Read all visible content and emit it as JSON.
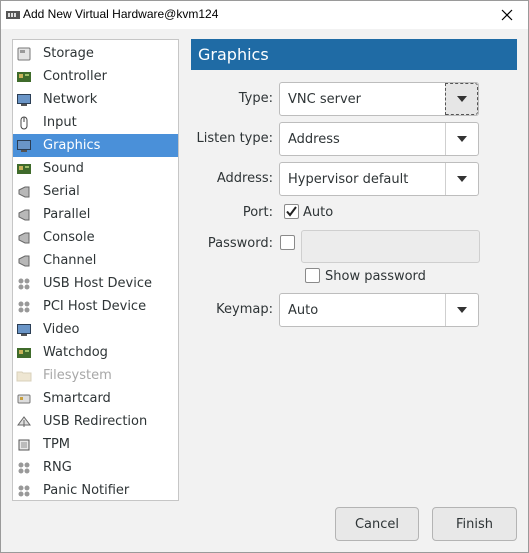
{
  "window": {
    "title": "Add New Virtual Hardware@kvm124"
  },
  "sidebar": {
    "items": [
      {
        "label": "Storage",
        "icon": "storage-icon"
      },
      {
        "label": "Controller",
        "icon": "controller-icon"
      },
      {
        "label": "Network",
        "icon": "network-icon"
      },
      {
        "label": "Input",
        "icon": "mouse-icon"
      },
      {
        "label": "Graphics",
        "icon": "monitor-icon",
        "selected": true
      },
      {
        "label": "Sound",
        "icon": "sound-card-icon"
      },
      {
        "label": "Serial",
        "icon": "serial-plug-icon"
      },
      {
        "label": "Parallel",
        "icon": "parallel-plug-icon"
      },
      {
        "label": "Console",
        "icon": "console-plug-icon"
      },
      {
        "label": "Channel",
        "icon": "channel-plug-icon"
      },
      {
        "label": "USB Host Device",
        "icon": "usb-device-icon"
      },
      {
        "label": "PCI Host Device",
        "icon": "pci-device-icon"
      },
      {
        "label": "Video",
        "icon": "video-monitor-icon"
      },
      {
        "label": "Watchdog",
        "icon": "watchdog-icon"
      },
      {
        "label": "Filesystem",
        "icon": "folder-icon",
        "disabled": true
      },
      {
        "label": "Smartcard",
        "icon": "smartcard-icon"
      },
      {
        "label": "USB Redirection",
        "icon": "usb-redirection-icon"
      },
      {
        "label": "TPM",
        "icon": "chip-icon"
      },
      {
        "label": "RNG",
        "icon": "rng-icon"
      },
      {
        "label": "Panic Notifier",
        "icon": "panic-notifier-icon"
      }
    ]
  },
  "panel": {
    "title": "Graphics",
    "type_label": "Type:",
    "type_value": "VNC server",
    "listen_type_label": "Listen type:",
    "listen_type_value": "Address",
    "address_label": "Address:",
    "address_value": "Hypervisor default",
    "port_label": "Port:",
    "port_auto_label": "Auto",
    "port_auto_checked": true,
    "password_label": "Password:",
    "password_value": "",
    "show_password_label": "Show password",
    "show_password_checked": false,
    "keymap_label": "Keymap:",
    "keymap_value": "Auto"
  },
  "buttons": {
    "cancel": "Cancel",
    "finish": "Finish"
  },
  "colors": {
    "header_bg": "#1f6ba5",
    "selection_bg": "#4a90d9",
    "window_bg": "#f2f2f2"
  }
}
